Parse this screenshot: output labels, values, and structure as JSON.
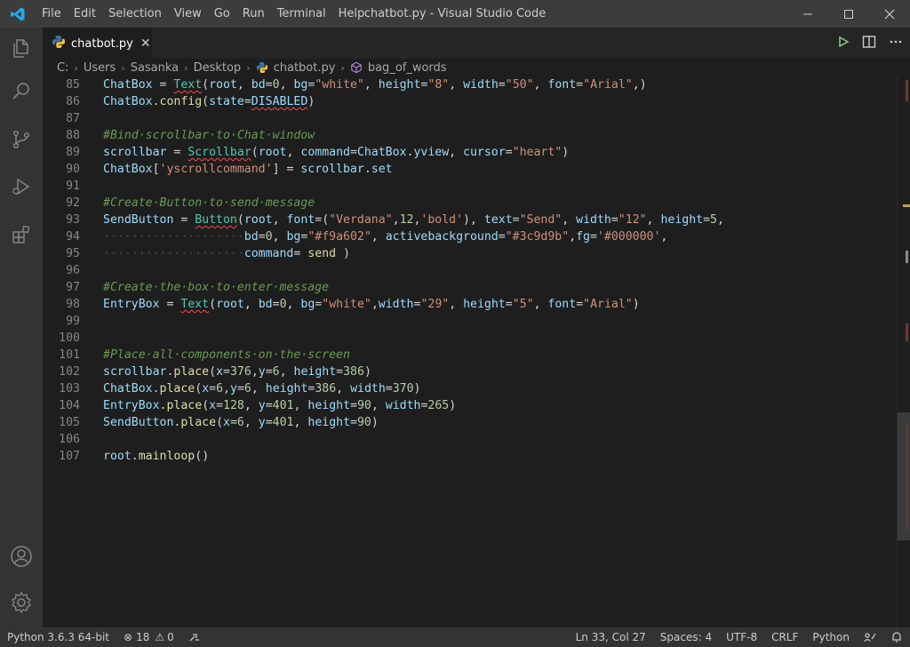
{
  "window": {
    "title": "chatbot.py - Visual Studio Code",
    "menu": [
      "File",
      "Edit",
      "Selection",
      "View",
      "Go",
      "Run",
      "Terminal",
      "Help"
    ]
  },
  "tabs": [
    {
      "label": "chatbot.py",
      "icon": "python-icon",
      "active": true
    }
  ],
  "breadcrumb": {
    "items": [
      "C:",
      "Users",
      "Sasanka",
      "Desktop",
      "chatbot.py",
      "bag_of_words"
    ]
  },
  "editor": {
    "lines": [
      {
        "n": "85",
        "tokens": [
          [
            "ChatBox",
            "v"
          ],
          [
            " = ",
            ""
          ],
          [
            "Text",
            "t sq"
          ],
          [
            "(",
            ""
          ],
          [
            "root",
            "v"
          ],
          [
            ", ",
            ""
          ],
          [
            "bd",
            "v"
          ],
          [
            "=",
            ""
          ],
          [
            "0",
            "n"
          ],
          [
            ", ",
            ""
          ],
          [
            "bg",
            "v"
          ],
          [
            "=",
            ""
          ],
          [
            "\"white\"",
            "s"
          ],
          [
            ", ",
            ""
          ],
          [
            "height",
            "v"
          ],
          [
            "=",
            ""
          ],
          [
            "\"8\"",
            "s"
          ],
          [
            ", ",
            ""
          ],
          [
            "width",
            "v"
          ],
          [
            "=",
            ""
          ],
          [
            "\"50\"",
            "s"
          ],
          [
            ", ",
            ""
          ],
          [
            "font",
            "v"
          ],
          [
            "=",
            ""
          ],
          [
            "\"Arial\"",
            "s"
          ],
          [
            ",)",
            ""
          ]
        ]
      },
      {
        "n": "86",
        "tokens": [
          [
            "ChatBox",
            "v"
          ],
          [
            ".",
            ""
          ],
          [
            "config",
            "f"
          ],
          [
            "(",
            ""
          ],
          [
            "state",
            "v"
          ],
          [
            "=",
            ""
          ],
          [
            "DISABLED",
            "v sq"
          ],
          [
            ")",
            ""
          ]
        ]
      },
      {
        "n": "87",
        "tokens": []
      },
      {
        "n": "88",
        "tokens": [
          [
            "#Bind·scrollbar·to·Chat·window",
            "c"
          ]
        ]
      },
      {
        "n": "89",
        "tokens": [
          [
            "scrollbar",
            "v"
          ],
          [
            " = ",
            ""
          ],
          [
            "Scrollbar",
            "t sq"
          ],
          [
            "(",
            ""
          ],
          [
            "root",
            "v"
          ],
          [
            ", ",
            ""
          ],
          [
            "command",
            "v"
          ],
          [
            "=",
            ""
          ],
          [
            "ChatBox",
            "v"
          ],
          [
            ".",
            ""
          ],
          [
            "yview",
            "v"
          ],
          [
            ", ",
            ""
          ],
          [
            "cursor",
            "v"
          ],
          [
            "=",
            ""
          ],
          [
            "\"heart\"",
            "s"
          ],
          [
            ")",
            ""
          ]
        ]
      },
      {
        "n": "90",
        "tokens": [
          [
            "ChatBox",
            "v"
          ],
          [
            "[",
            ""
          ],
          [
            "'yscrollcommand'",
            "s"
          ],
          [
            "] = ",
            ""
          ],
          [
            "scrollbar",
            "v"
          ],
          [
            ".",
            ""
          ],
          [
            "set",
            "v"
          ]
        ]
      },
      {
        "n": "91",
        "tokens": []
      },
      {
        "n": "92",
        "tokens": [
          [
            "#Create·Button·to·send·message",
            "c"
          ]
        ]
      },
      {
        "n": "93",
        "tokens": [
          [
            "SendButton",
            "v"
          ],
          [
            " = ",
            ""
          ],
          [
            "Button",
            "t sq"
          ],
          [
            "(",
            ""
          ],
          [
            "root",
            "v"
          ],
          [
            ", ",
            ""
          ],
          [
            "font",
            "v"
          ],
          [
            "=(",
            ""
          ],
          [
            "\"Verdana\"",
            "s"
          ],
          [
            ",",
            ""
          ],
          [
            "12",
            "n"
          ],
          [
            ",",
            ""
          ],
          [
            "'bold'",
            "s"
          ],
          [
            "), ",
            ""
          ],
          [
            "text",
            "v"
          ],
          [
            "=",
            ""
          ],
          [
            "\"Send\"",
            "s"
          ],
          [
            ", ",
            ""
          ],
          [
            "width",
            "v"
          ],
          [
            "=",
            ""
          ],
          [
            "\"12\"",
            "s"
          ],
          [
            ", ",
            ""
          ],
          [
            "height",
            "v"
          ],
          [
            "=",
            ""
          ],
          [
            "5",
            "n"
          ],
          [
            ",",
            ""
          ]
        ]
      },
      {
        "n": "94",
        "tokens": [
          [
            "····················",
            "d"
          ],
          [
            "bd",
            "v"
          ],
          [
            "=",
            ""
          ],
          [
            "0",
            "n"
          ],
          [
            ", ",
            ""
          ],
          [
            "bg",
            "v"
          ],
          [
            "=",
            ""
          ],
          [
            "\"#f9a602\"",
            "s"
          ],
          [
            ", ",
            ""
          ],
          [
            "activebackground",
            "v"
          ],
          [
            "=",
            ""
          ],
          [
            "\"#3c9d9b\"",
            "s"
          ],
          [
            ",",
            ""
          ],
          [
            "fg",
            "v"
          ],
          [
            "=",
            ""
          ],
          [
            "'#000000'",
            "s"
          ],
          [
            ",",
            ""
          ]
        ]
      },
      {
        "n": "95",
        "tokens": [
          [
            "····················",
            "d"
          ],
          [
            "command",
            "v"
          ],
          [
            "= ",
            ""
          ],
          [
            "send",
            "f"
          ],
          [
            " )",
            ""
          ]
        ]
      },
      {
        "n": "96",
        "tokens": []
      },
      {
        "n": "97",
        "tokens": [
          [
            "#Create·the·box·to·enter·message",
            "c"
          ]
        ]
      },
      {
        "n": "98",
        "tokens": [
          [
            "EntryBox",
            "v"
          ],
          [
            " = ",
            ""
          ],
          [
            "Text",
            "t sq"
          ],
          [
            "(",
            ""
          ],
          [
            "root",
            "v"
          ],
          [
            ", ",
            ""
          ],
          [
            "bd",
            "v"
          ],
          [
            "=",
            ""
          ],
          [
            "0",
            "n"
          ],
          [
            ", ",
            ""
          ],
          [
            "bg",
            "v"
          ],
          [
            "=",
            ""
          ],
          [
            "\"white\"",
            "s"
          ],
          [
            ",",
            ""
          ],
          [
            "width",
            "v"
          ],
          [
            "=",
            ""
          ],
          [
            "\"29\"",
            "s"
          ],
          [
            ", ",
            ""
          ],
          [
            "height",
            "v"
          ],
          [
            "=",
            ""
          ],
          [
            "\"5\"",
            "s"
          ],
          [
            ", ",
            ""
          ],
          [
            "font",
            "v"
          ],
          [
            "=",
            ""
          ],
          [
            "\"Arial\"",
            "s"
          ],
          [
            ")",
            ""
          ]
        ]
      },
      {
        "n": "99",
        "tokens": []
      },
      {
        "n": "100",
        "tokens": []
      },
      {
        "n": "101",
        "tokens": [
          [
            "#Place·all·components·on·the·screen",
            "c"
          ]
        ]
      },
      {
        "n": "102",
        "tokens": [
          [
            "scrollbar",
            "v"
          ],
          [
            ".",
            ""
          ],
          [
            "place",
            "f"
          ],
          [
            "(",
            ""
          ],
          [
            "x",
            "v"
          ],
          [
            "=",
            ""
          ],
          [
            "376",
            "n"
          ],
          [
            ",",
            ""
          ],
          [
            "y",
            "v"
          ],
          [
            "=",
            ""
          ],
          [
            "6",
            "n"
          ],
          [
            ", ",
            ""
          ],
          [
            "height",
            "v"
          ],
          [
            "=",
            ""
          ],
          [
            "386",
            "n"
          ],
          [
            ")",
            ""
          ]
        ]
      },
      {
        "n": "103",
        "tokens": [
          [
            "ChatBox",
            "v"
          ],
          [
            ".",
            ""
          ],
          [
            "place",
            "f"
          ],
          [
            "(",
            ""
          ],
          [
            "x",
            "v"
          ],
          [
            "=",
            ""
          ],
          [
            "6",
            "n"
          ],
          [
            ",",
            ""
          ],
          [
            "y",
            "v"
          ],
          [
            "=",
            ""
          ],
          [
            "6",
            "n"
          ],
          [
            ", ",
            ""
          ],
          [
            "height",
            "v"
          ],
          [
            "=",
            ""
          ],
          [
            "386",
            "n"
          ],
          [
            ", ",
            ""
          ],
          [
            "width",
            "v"
          ],
          [
            "=",
            ""
          ],
          [
            "370",
            "n"
          ],
          [
            ")",
            ""
          ]
        ]
      },
      {
        "n": "104",
        "tokens": [
          [
            "EntryBox",
            "v"
          ],
          [
            ".",
            ""
          ],
          [
            "place",
            "f"
          ],
          [
            "(",
            ""
          ],
          [
            "x",
            "v"
          ],
          [
            "=",
            ""
          ],
          [
            "128",
            "n"
          ],
          [
            ", ",
            ""
          ],
          [
            "y",
            "v"
          ],
          [
            "=",
            ""
          ],
          [
            "401",
            "n"
          ],
          [
            ", ",
            ""
          ],
          [
            "height",
            "v"
          ],
          [
            "=",
            ""
          ],
          [
            "90",
            "n"
          ],
          [
            ", ",
            ""
          ],
          [
            "width",
            "v"
          ],
          [
            "=",
            ""
          ],
          [
            "265",
            "n"
          ],
          [
            ")",
            ""
          ]
        ]
      },
      {
        "n": "105",
        "tokens": [
          [
            "SendButton",
            "v"
          ],
          [
            ".",
            ""
          ],
          [
            "place",
            "f"
          ],
          [
            "(",
            ""
          ],
          [
            "x",
            "v"
          ],
          [
            "=",
            ""
          ],
          [
            "6",
            "n"
          ],
          [
            ", ",
            ""
          ],
          [
            "y",
            "v"
          ],
          [
            "=",
            ""
          ],
          [
            "401",
            "n"
          ],
          [
            ", ",
            ""
          ],
          [
            "height",
            "v"
          ],
          [
            "=",
            ""
          ],
          [
            "90",
            "n"
          ],
          [
            ")",
            ""
          ]
        ]
      },
      {
        "n": "106",
        "tokens": []
      },
      {
        "n": "107",
        "tokens": [
          [
            "root",
            "v"
          ],
          [
            ".",
            ""
          ],
          [
            "mainloop",
            "f"
          ],
          [
            "()",
            ""
          ]
        ]
      }
    ]
  },
  "statusbar": {
    "interpreter": "Python 3.6.3 64-bit",
    "errors": "18",
    "warnings": "0",
    "position": "Ln 33, Col 27",
    "spaces": "Spaces: 4",
    "encoding": "UTF-8",
    "eol": "CRLF",
    "language": "Python"
  },
  "colors": {
    "accent": "#007acc",
    "titlebar": "#3c3c3c",
    "activitybar": "#333333",
    "editor_bg": "#1e1e1e"
  }
}
